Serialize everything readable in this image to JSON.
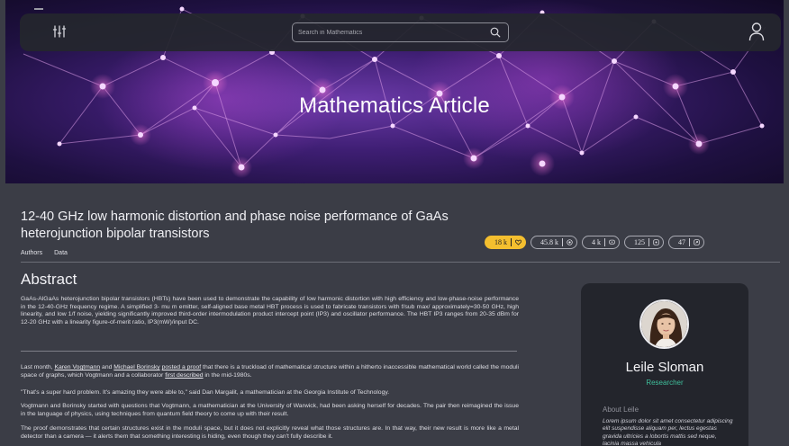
{
  "search": {
    "placeholder": "Search in Mathematics"
  },
  "hero": {
    "title": "Mathematics Article"
  },
  "article": {
    "title": "12-40 GHz low harmonic distortion and phase noise performance of GaAs heterojunction bipolar transistors",
    "tabs": [
      "Authors",
      "Data"
    ],
    "metrics": [
      {
        "value": "18 k",
        "icon": "heart-icon",
        "active": true
      },
      {
        "value": "45.8 k",
        "icon": "eye-icon",
        "active": false
      },
      {
        "value": "4 k",
        "icon": "chat-icon",
        "active": false
      },
      {
        "value": "125",
        "icon": "quote-icon",
        "active": false
      },
      {
        "value": "47",
        "icon": "share-icon",
        "active": false
      }
    ],
    "abstract_heading": "Abstract",
    "abstract_text": "GaAs-AlGaAs heterojunction bipolar transistors (HBTs) have been used to demonstrate the capability of low harmonic distortion with high efficiency and low-phase-noise performance in the 12-40-GHz frequency regime. A simplified 3- mu m emitter, self-aligned base metal HBT process is used to fabricate transistors with f/sub max/ approximately=30-50 GHz, high linearity, and low 1/f noise, yielding significantly improved third-order intermodulation product intercept point (IP3) and oscillator performance. The HBT IP3 ranges from 20-35 dBm for 12-20 GHz with a linearity figure-of-merit ratio, IP3(mW)/input DC.",
    "p1": {
      "t1": "Last month, ",
      "link1": "Karen Vogtmann",
      "t2": " and ",
      "link2": "Michael Borinsky",
      "t3": " ",
      "link3": "posted a proof",
      "t4": " that there is a truckload of mathematical structure within a hitherto inaccessible mathematical world called the moduli space of graphs, which Vogtmann and a collaborator ",
      "link4": "first described",
      "t5": " in the mid-1980s."
    },
    "p2": "\"That's a super hard problem. It's amazing they were able to,\" said Dan Margalit, a mathematician at the Georgia Institute of Technology.",
    "p3": "Vogtmann and Borinsky started with questions that Vogtmann, a mathematician at the University of Warwick, had been asking herself for decades. The pair then reimagined the issue in the language of physics, using techniques from quantum field theory to come up with their result.",
    "p4": "The proof demonstrates that certain structures exist in the moduli space, but it does not explicitly reveal what those structures are. In that way, their new result is more like a metal detector than a camera — it alerts them that something interesting is hiding, even though they can't fully describe it."
  },
  "author": {
    "name": "Leile Sloman",
    "role": "Researcher",
    "about_heading": "About Leile",
    "about_text": "Lorem ipsum dolor sit amet consectetur adipiscing elit suspendisse aliquam per, lectus egestas gravida ultricies a lobortis mattis sed neque, lacinia massa vehicula"
  },
  "colors": {
    "accent": "#f4bf2f",
    "role": "#3fbf9b",
    "card": "#23252c",
    "page": "#3b3d46"
  }
}
